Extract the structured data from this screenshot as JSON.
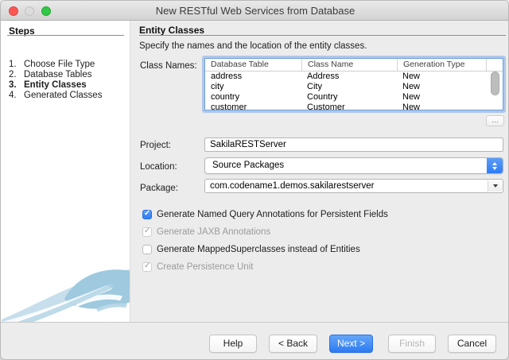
{
  "window": {
    "title": "New RESTful Web Services from Database"
  },
  "sidebar": {
    "heading": "Steps",
    "steps": [
      {
        "num": "1.",
        "label": "Choose File Type",
        "active": "false"
      },
      {
        "num": "2.",
        "label": "Database Tables",
        "active": "false"
      },
      {
        "num": "3.",
        "label": "Entity Classes",
        "active": "true"
      },
      {
        "num": "4.",
        "label": "Generated Classes",
        "active": "false"
      }
    ]
  },
  "content": {
    "heading": "Entity Classes",
    "description": "Specify the names and the location of the entity classes.",
    "class_names_label": "Class Names:",
    "table": {
      "columns": [
        "Database Table",
        "Class Name",
        "Generation Type"
      ],
      "rows": [
        [
          "address",
          "Address",
          "New"
        ],
        [
          "city",
          "City",
          "New"
        ],
        [
          "country",
          "Country",
          "New"
        ],
        [
          "customer",
          "Customer",
          "New"
        ]
      ]
    },
    "more_button": "…",
    "project": {
      "label": "Project:",
      "value": "SakilaRESTServer"
    },
    "location": {
      "label": "Location:",
      "value": "Source Packages"
    },
    "package": {
      "label": "Package:",
      "value": "com.codename1.demos.sakilarestserver"
    },
    "checkboxes": [
      {
        "label": "Generate Named Query Annotations for Persistent Fields",
        "state": "on"
      },
      {
        "label": "Generate JAXB Annotations",
        "state": "on-disabled"
      },
      {
        "label": "Generate MappedSuperclasses instead of Entities",
        "state": "off"
      },
      {
        "label": "Create Persistence Unit",
        "state": "on-disabled"
      }
    ]
  },
  "footer": {
    "buttons": [
      {
        "label": "Help",
        "variant": "default"
      },
      {
        "label": "< Back",
        "variant": "default"
      },
      {
        "label": "Next >",
        "variant": "primary"
      },
      {
        "label": "Finish",
        "variant": "disabled"
      },
      {
        "label": "Cancel",
        "variant": "default"
      }
    ]
  },
  "colors": {
    "accent_blue": "#3b82f7",
    "focus_ring": "#7aa8e0",
    "disabled_text": "#9b9b9b"
  }
}
